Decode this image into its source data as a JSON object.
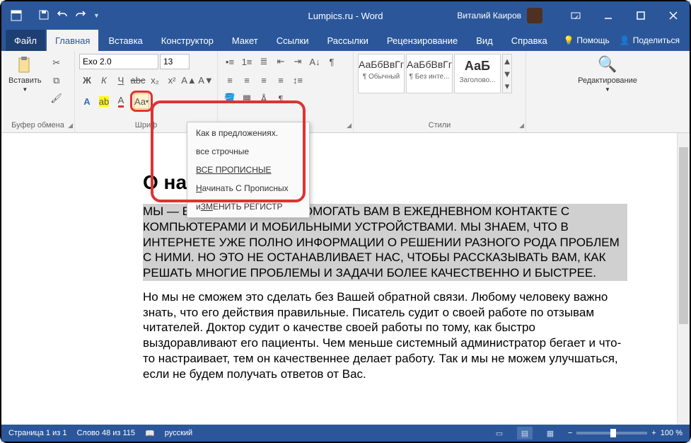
{
  "titlebar": {
    "title": "Lumpics.ru - Word",
    "user_name": "Виталий Каиров"
  },
  "tabs": {
    "file": "Файл",
    "home": "Главная",
    "insert": "Вставка",
    "design": "Конструктор",
    "layout": "Макет",
    "references": "Ссылки",
    "mailings": "Рассылки",
    "review": "Рецензирование",
    "view": "Вид",
    "help": "Справка",
    "tell_me": "Помощь",
    "share": "Поделиться"
  },
  "ribbon": {
    "clipboard": {
      "label": "Буфер обмена",
      "paste": "Вставить"
    },
    "font": {
      "label": "Шриф",
      "name": "Exo 2.0",
      "size": "13"
    },
    "paragraph": {
      "label": ""
    },
    "styles": {
      "label": "Стили",
      "s1": {
        "sample": "АаБбВвГг",
        "name": "¶ Обычный"
      },
      "s2": {
        "sample": "АаБбВвГг",
        "name": "¶ Без инте..."
      },
      "s3": {
        "sample": "АаБ",
        "name": "Заголово..."
      }
    },
    "editing": {
      "label": "Редактирование"
    }
  },
  "case_menu": {
    "sentence": "Как в предложениях.",
    "lower": "все строчные",
    "upper": "ВСЕ ПРОПИСНЫЕ",
    "capitalize_pre": "Н",
    "capitalize_rest": "ачинать С Прописных",
    "toggle_pre": "и",
    "toggle_mid": "ЗМ",
    "toggle_rest": "ЕНИТЬ РЕГИСТР"
  },
  "document": {
    "title": "О на",
    "p1": "МЫ —                                                             ЕРЖИМЫХ ИДЕЕЙ ПОМОГАТЬ ВАМ В ЕЖЕДНЕВНОМ КОНТАКТЕ С КОМПЬЮТЕРАМИ И МОБИЛЬНЫМИ УСТРОЙСТВАМИ. МЫ ЗНАЕМ, ЧТО В ИНТЕРНЕТЕ УЖЕ ПОЛНО ИНФОРМАЦИИ О РЕШЕНИИ РАЗНОГО РОДА ПРОБЛЕМ С НИМИ. НО ЭТО НЕ ОСТАНАВЛИВАЕТ НАС, ЧТОБЫ РАССКАЗЫВАТЬ ВАМ, КАК РЕШАТЬ МНОГИЕ ПРОБЛЕМЫ И ЗАДАЧИ БОЛЕЕ КАЧЕСТВЕННО И БЫСТРЕЕ.",
    "p2": "Но мы не сможем это сделать без Вашей обратной связи. Любому человеку важно знать, что его действия правильные. Писатель судит о своей работе по отзывам читателей. Доктор судит о качестве своей работы по тому, как быстро выздоравливают его пациенты. Чем меньше системный администратор бегает и что-то настраивает, тем он качественнее делает работу. Так и мы не можем улучшаться, если не будем получать ответов от Вас."
  },
  "status": {
    "page": "Страница 1 из 1",
    "words": "Слово 48 из 115",
    "lang": "русский",
    "zoom": "100 %"
  }
}
